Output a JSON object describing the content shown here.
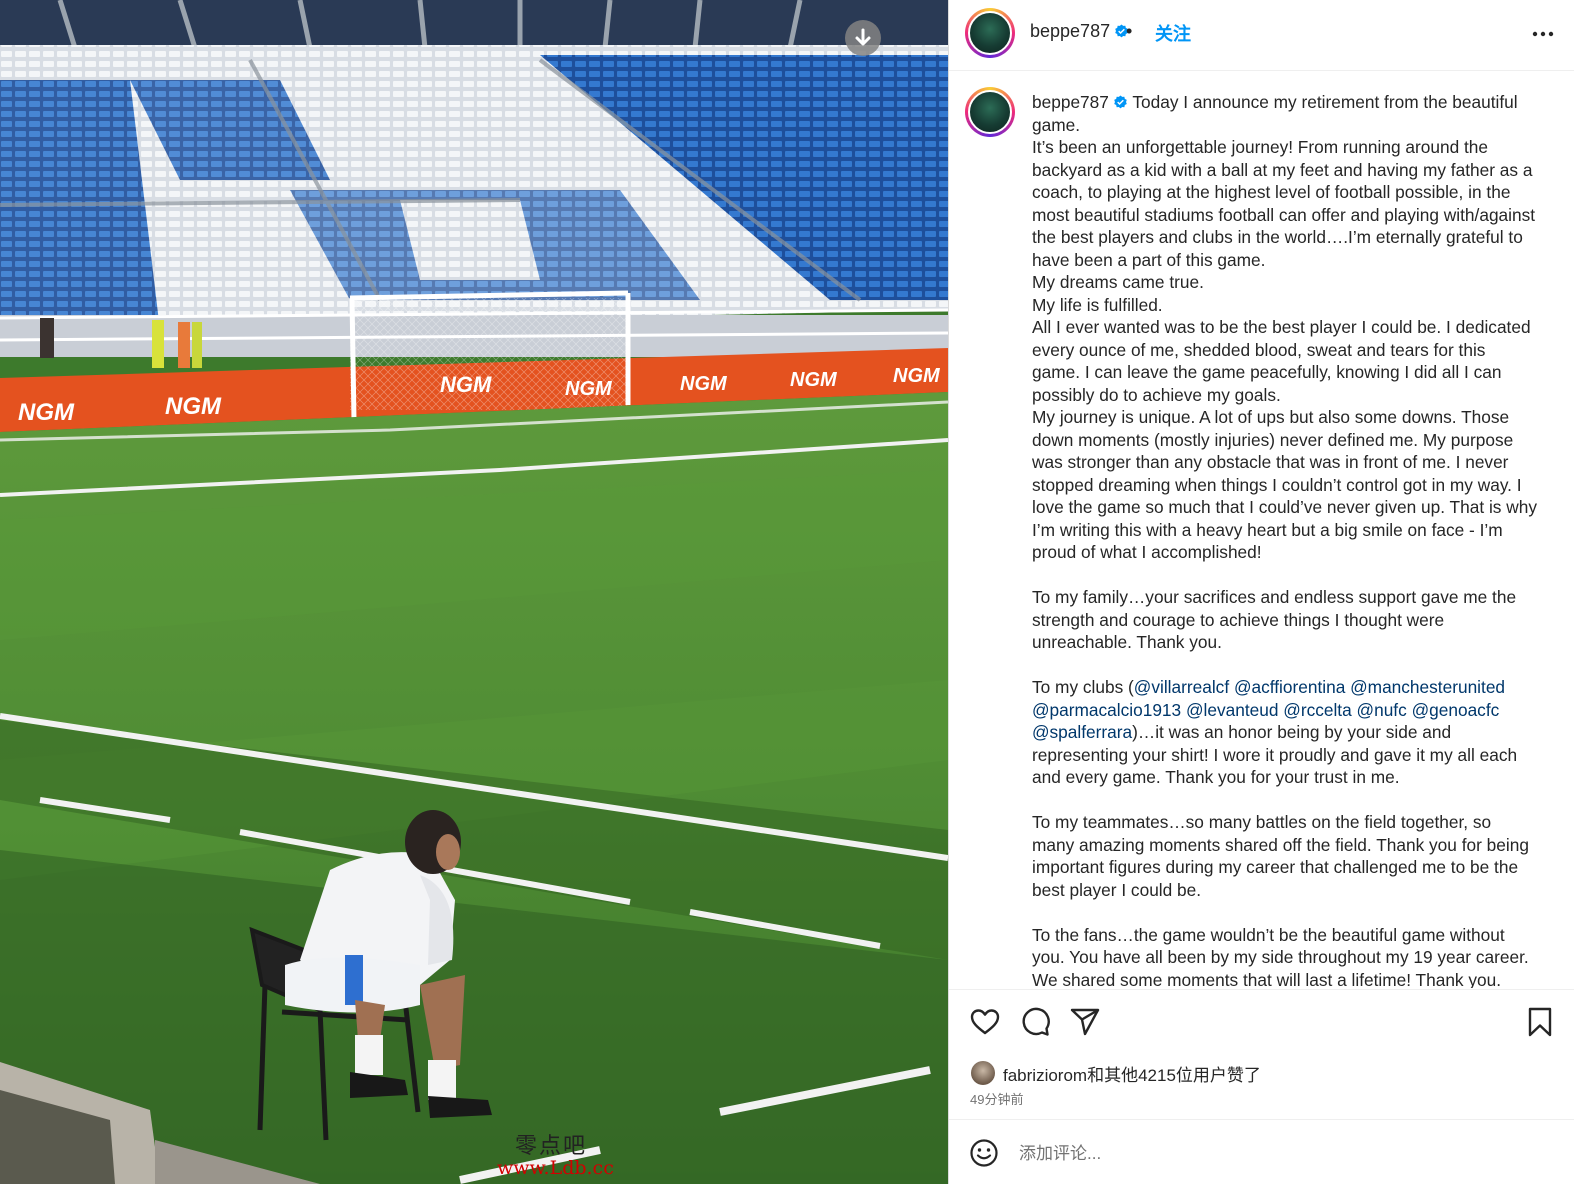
{
  "post": {
    "username": "beppe787",
    "dot": "•",
    "follow_label": "关注"
  },
  "photo": {
    "ad_board_text": "NGM",
    "download_icon": "download-icon"
  },
  "caption": {
    "username": "beppe787",
    "p1": "Today I announce my retirement from the beautiful game.\nIt’s been an unforgettable journey! From running around the backyard as a kid with a ball at my feet and having my father as a coach, to playing at the highest level of football possible, in the most beautiful stadiums football can offer and playing with/against the best players and clubs in the world….I’m eternally grateful to have been a part of this game.\nMy dreams came true.\nMy life is fulfilled.\nAll I ever wanted was to be the best player I could be. I dedicated every ounce of me, shedded blood, sweat and tears for this game. I can leave the game peacefully, knowing I did all I can possibly do to achieve my goals.\nMy journey is unique. A lot of ups but also some downs. Those down moments (mostly injuries) never defined me. My purpose was stronger than any obstacle that was in front of me. I never stopped dreaming when things I couldn’t control got in my way. I love the game so much that I could’ve never given up. That is why I’m writing this with a heavy heart but a big smile on face - I’m proud of what I accomplished!\n\nTo my family…your sacrifices and endless support gave me the strength and courage to achieve things I thought were unreachable. Thank you.\n\nTo my clubs (",
    "mentions": [
      "@villarrealcf",
      "@acffiorentina",
      "@manchesterunited",
      "@parmacalcio1913",
      "@levanteud",
      "@rccelta",
      "@nufc",
      "@genoacfc",
      "@spalferrara"
    ],
    "p2": ")…it was an honor being by your side and representing your shirt! I wore it proudly and gave it my all each and every game. Thank you for your trust in me.\n\nTo my teammates…so many battles on the field together, so many amazing moments shared off the field. Thank you for being important figures during my career that challenged me to be the best player I could be.\n\nTo the fans…the game wouldn’t be the beautiful game without you. You have all been by my side throughout my 19 year career. We shared some moments that will last a lifetime! Thank you."
  },
  "actions": {
    "like_icon": "heart-icon",
    "comment_icon": "comment-icon",
    "share_icon": "send-icon",
    "save_icon": "bookmark-icon"
  },
  "likes": {
    "user": "fabriziorom",
    "text": "和其他4215位用户赞了"
  },
  "timestamp": "49分钟前",
  "comment": {
    "placeholder": "添加评论..."
  },
  "watermark": {
    "cn": "零点吧",
    "url": "www.Ldb.cc"
  },
  "colors": {
    "accent": "#0095f6",
    "mention": "#00376b",
    "seat_blue": "#2f6fc6",
    "grass": "#4a8a33",
    "ad_board": "#e8531f"
  }
}
